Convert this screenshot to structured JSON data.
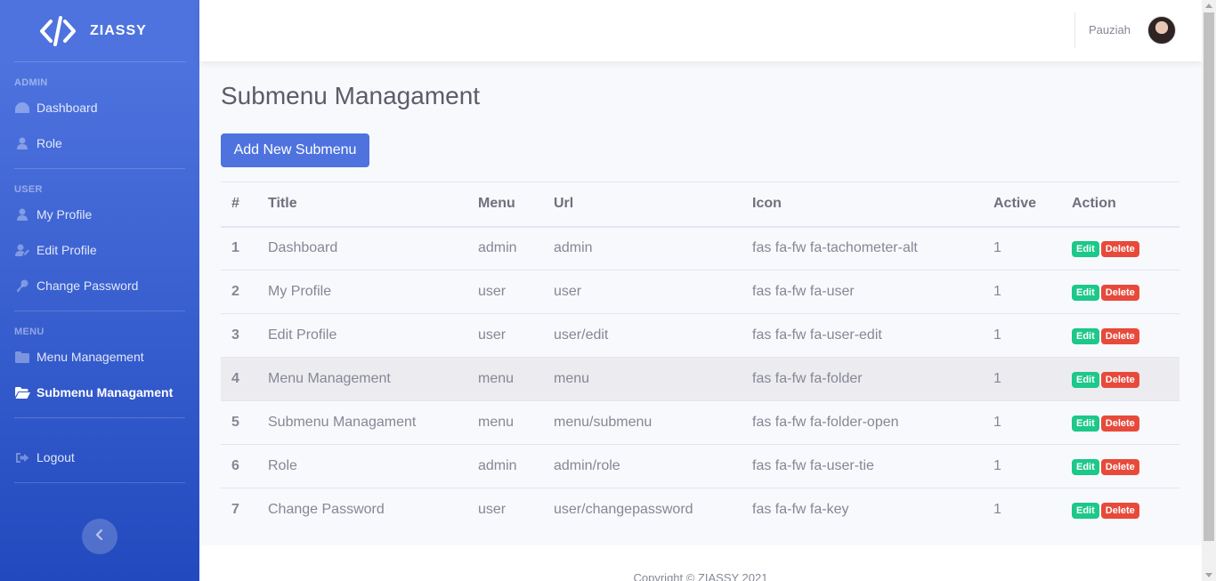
{
  "brand": {
    "name": "ZIASSY"
  },
  "sidebar": {
    "sections": [
      {
        "heading": "ADMIN",
        "items": [
          {
            "label": "Dashboard",
            "icon": "tachometer-icon"
          },
          {
            "label": "Role",
            "icon": "user-tie-icon"
          }
        ]
      },
      {
        "heading": "USER",
        "items": [
          {
            "label": "My Profile",
            "icon": "user-icon"
          },
          {
            "label": "Edit Profile",
            "icon": "user-edit-icon"
          },
          {
            "label": "Change Password",
            "icon": "key-icon"
          }
        ]
      },
      {
        "heading": "MENU",
        "items": [
          {
            "label": "Menu Management",
            "icon": "folder-icon"
          },
          {
            "label": "Submenu Managament",
            "icon": "folder-open-icon",
            "active": true
          }
        ]
      }
    ],
    "logout_label": "Logout"
  },
  "topbar": {
    "user_name": "Pauziah"
  },
  "main": {
    "title": "Submenu Managament",
    "add_button": "Add New Submenu",
    "table": {
      "columns": [
        "#",
        "Title",
        "Menu",
        "Url",
        "Icon",
        "Active",
        "Action"
      ],
      "rows": [
        {
          "idx": "1",
          "title": "Dashboard",
          "menu": "admin",
          "url": "admin",
          "icon": "fas fa-fw fa-tachometer-alt",
          "active": "1"
        },
        {
          "idx": "2",
          "title": "My Profile",
          "menu": "user",
          "url": "user",
          "icon": "fas fa-fw fa-user",
          "active": "1"
        },
        {
          "idx": "3",
          "title": "Edit Profile",
          "menu": "user",
          "url": "user/edit",
          "icon": "fas fa-fw fa-user-edit",
          "active": "1"
        },
        {
          "idx": "4",
          "title": "Menu Management",
          "menu": "menu",
          "url": "menu",
          "icon": "fas fa-fw fa-folder",
          "active": "1"
        },
        {
          "idx": "5",
          "title": "Submenu Managament",
          "menu": "menu",
          "url": "menu/submenu",
          "icon": "fas fa-fw fa-folder-open",
          "active": "1"
        },
        {
          "idx": "6",
          "title": "Role",
          "menu": "admin",
          "url": "admin/role",
          "icon": "fas fa-fw fa-user-tie",
          "active": "1"
        },
        {
          "idx": "7",
          "title": "Change Password",
          "menu": "user",
          "url": "user/changepassword",
          "icon": "fas fa-fw fa-key",
          "active": "1"
        }
      ],
      "edit_label": "Edit",
      "delete_label": "Delete"
    }
  },
  "footer": {
    "text": "Copyright © ZIASSY 2021"
  },
  "colors": {
    "primary": "#4e73df",
    "success": "#1cc88a",
    "danger": "#e74a3b"
  }
}
